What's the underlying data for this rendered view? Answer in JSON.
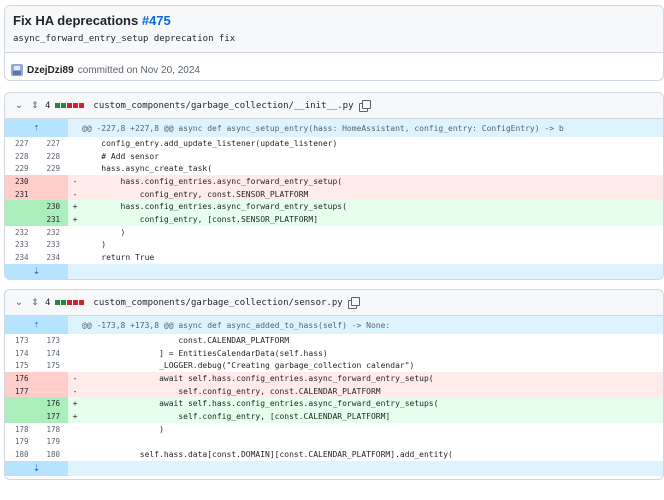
{
  "commit": {
    "title": "Fix HA deprecations",
    "pr": "#475",
    "description": "async_forward_entry_setup deprecation fix",
    "author": "DzejDzi89",
    "committed_text": "committed on Nov 20, 2024"
  },
  "files": [
    {
      "changes": "4",
      "path": "custom_components/garbage_collection/__init__.py",
      "hunk": "@@ -227,8 +227,8 @@ async def async_setup_entry(hass: HomeAssistant, config_entry: ConfigEntry) -> b",
      "lines": [
        {
          "type": "ctx",
          "old": "227",
          "new": "227",
          "sign": "",
          "code": "    config_entry.add_update_listener(update_listener)"
        },
        {
          "type": "ctx",
          "old": "228",
          "new": "228",
          "sign": "",
          "code": "    # Add sensor"
        },
        {
          "type": "ctx",
          "old": "229",
          "new": "229",
          "sign": "",
          "code": "    hass.async_create_task("
        },
        {
          "type": "del",
          "old": "230",
          "new": "",
          "sign": "-",
          "code": "        hass.config_entries.async_forward_entry_setup("
        },
        {
          "type": "del",
          "old": "231",
          "new": "",
          "sign": "-",
          "code": "            config_entry, const.SENSOR_PLATFORM"
        },
        {
          "type": "add",
          "old": "",
          "new": "230",
          "sign": "+",
          "code": "        hass.config_entries.async_forward_entry_setups("
        },
        {
          "type": "add",
          "old": "",
          "new": "231",
          "sign": "+",
          "code": "            config_entry, [const.SENSOR_PLATFORM]"
        },
        {
          "type": "ctx",
          "old": "232",
          "new": "232",
          "sign": "",
          "code": "        )"
        },
        {
          "type": "ctx",
          "old": "233",
          "new": "233",
          "sign": "",
          "code": "    )"
        },
        {
          "type": "ctx",
          "old": "234",
          "new": "234",
          "sign": "",
          "code": "    return True"
        }
      ]
    },
    {
      "changes": "4",
      "path": "custom_components/garbage_collection/sensor.py",
      "hunk": "@@ -173,8 +173,8 @@ async def async_added_to_hass(self) -> None:",
      "lines": [
        {
          "type": "ctx",
          "old": "173",
          "new": "173",
          "sign": "",
          "code": "                    const.CALENDAR_PLATFORM"
        },
        {
          "type": "ctx",
          "old": "174",
          "new": "174",
          "sign": "",
          "code": "                ] = EntitiesCalendarData(self.hass)"
        },
        {
          "type": "ctx",
          "old": "175",
          "new": "175",
          "sign": "",
          "code": "                _LOGGER.debug(\"Creating garbage_collection calendar\")"
        },
        {
          "type": "del",
          "old": "176",
          "new": "",
          "sign": "-",
          "code": "                await self.hass.config_entries.async_forward_entry_setup("
        },
        {
          "type": "del",
          "old": "177",
          "new": "",
          "sign": "-",
          "code": "                    self.config_entry, const.CALENDAR_PLATFORM"
        },
        {
          "type": "add",
          "old": "",
          "new": "176",
          "sign": "+",
          "code": "                await self.hass.config_entries.async_forward_entry_setups("
        },
        {
          "type": "add",
          "old": "",
          "new": "177",
          "sign": "+",
          "code": "                    self.config_entry, [const.CALENDAR_PLATFORM]"
        },
        {
          "type": "ctx",
          "old": "178",
          "new": "178",
          "sign": "",
          "code": "                )"
        },
        {
          "type": "ctx",
          "old": "179",
          "new": "179",
          "sign": "",
          "code": ""
        },
        {
          "type": "ctx",
          "old": "180",
          "new": "180",
          "sign": "",
          "code": "            self.hass.data[const.DOMAIN][const.CALENDAR_PLATFORM].add_entity("
        }
      ]
    }
  ],
  "colors": {
    "link": "#0969da",
    "added": "#1f883d",
    "deleted": "#cf222e"
  }
}
